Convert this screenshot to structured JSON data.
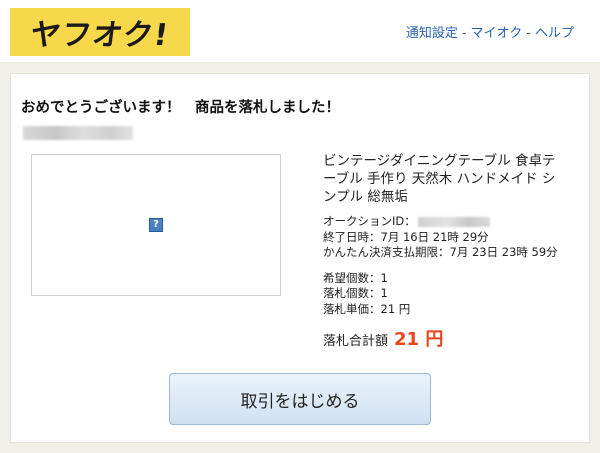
{
  "header": {
    "logo_text": "ヤフオク!",
    "nav": [
      {
        "label": "通知設定"
      },
      {
        "label": "マイオク"
      },
      {
        "label": "ヘルプ"
      }
    ],
    "separator": "-"
  },
  "main": {
    "headline": "おめでとうございます！　商品を落札しました！",
    "item_title": "ビンテージダイニングテーブル 食卓テーブル 手作り 天然木 ハンドメイド シンプル 総無垢",
    "auction_id_label": "オークションID：",
    "end_time": "終了日時：7月 16日 21時 29分",
    "payment_deadline": "かんたん決済支払期限：7月 23日 23時 59分",
    "desired_qty": "希望個数：1",
    "won_qty": "落札個数：1",
    "unit_price": "落札単価：21 円",
    "total_label": "落札合計額",
    "total_amount": "21 円",
    "cta_label": "取引をはじめる"
  },
  "colors": {
    "logo_bg": "#f6d84a",
    "link": "#2a63b4",
    "price": "#e8451d",
    "page_bg": "#f0efea"
  }
}
